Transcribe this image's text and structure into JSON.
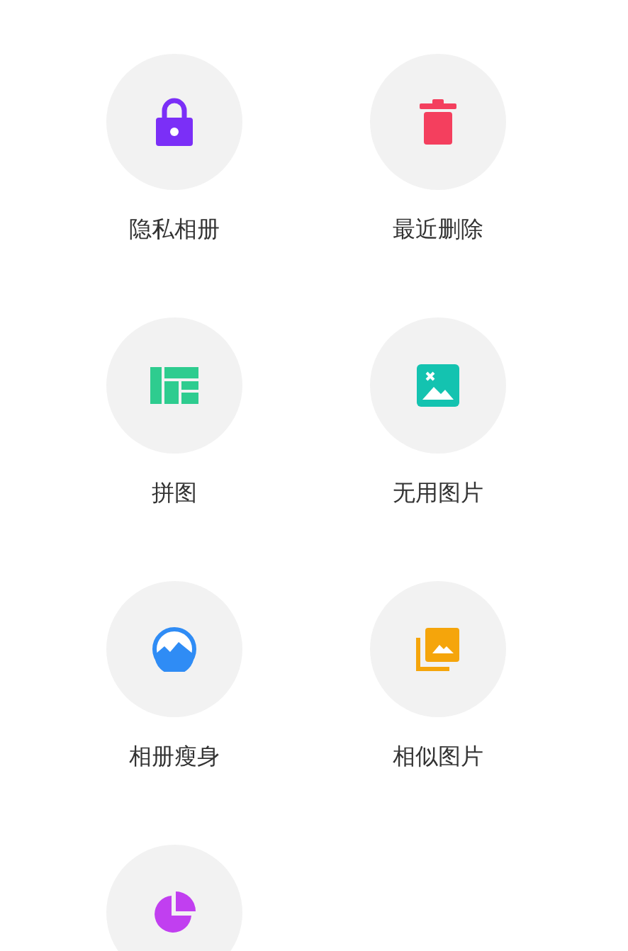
{
  "tools": [
    {
      "kind": "lock",
      "color": "#7b2ff7",
      "label": "隐私相册"
    },
    {
      "kind": "trash",
      "color": "#f43f5e",
      "label": "最近删除"
    },
    {
      "kind": "collage",
      "color": "#2ecc8f",
      "label": "拼图"
    },
    {
      "kind": "broken-image",
      "color": "#14c3b0",
      "label": "无用图片"
    },
    {
      "kind": "mountain",
      "color": "#2f8cf5",
      "label": "相册瘦身"
    },
    {
      "kind": "stack",
      "color": "#f5a50b",
      "label": "相似图片"
    },
    {
      "kind": "pie",
      "color": "#c13ff0"
    }
  ]
}
